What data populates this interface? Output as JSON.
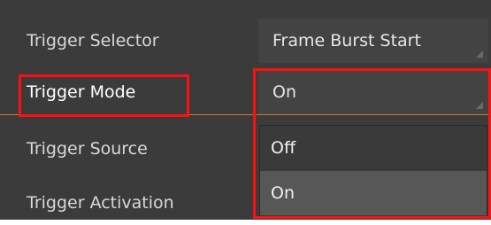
{
  "properties": {
    "trigger_selector": {
      "label": "Trigger Selector",
      "value": "Frame Burst Start"
    },
    "trigger_mode": {
      "label": "Trigger Mode",
      "value": "On"
    },
    "trigger_source": {
      "label": "Trigger Source"
    },
    "trigger_activation": {
      "label": "Trigger Activation"
    }
  },
  "trigger_mode_options": [
    "Off",
    "On"
  ],
  "colors": {
    "panel_background": "#3b3b3b",
    "highlight_border": "#ff1010",
    "selection_underline": "#c97a1e",
    "selected_option": "#575757"
  },
  "icons": {
    "dropdown_corner": "resize-grip-icon"
  }
}
